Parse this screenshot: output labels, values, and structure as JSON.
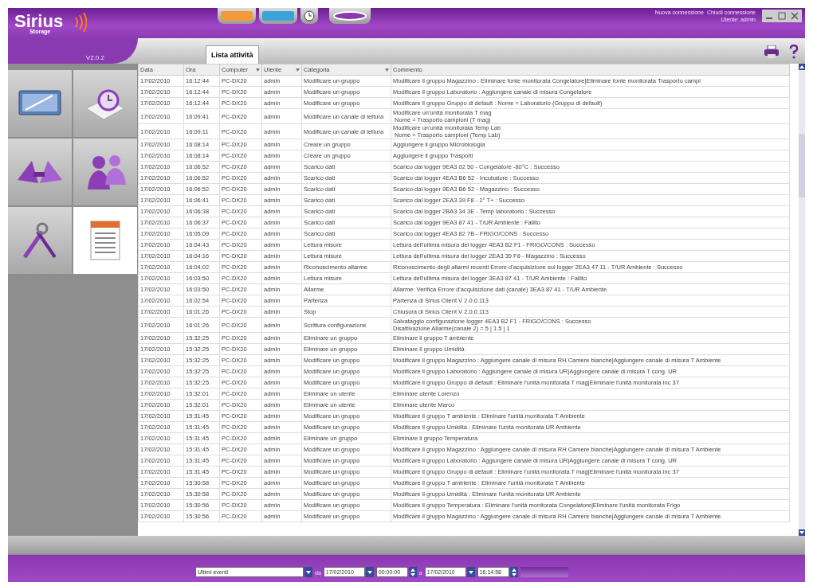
{
  "header": {
    "logo": "Sirius",
    "logo_sub": "Storage",
    "version": "V2.0.2",
    "links": [
      "Nuova connessione",
      "Chiudi connessione"
    ],
    "user": "Utente: admin"
  },
  "tab": {
    "label": "Lista attività",
    "selected": true
  },
  "nav_tiles": [
    {
      "kind": "monitor",
      "selected": false
    },
    {
      "kind": "clock",
      "selected": false
    },
    {
      "kind": "sensors",
      "selected": false
    },
    {
      "kind": "users",
      "selected": false
    },
    {
      "kind": "tools",
      "selected": false
    },
    {
      "kind": "log",
      "selected": true
    }
  ],
  "table": {
    "columns": [
      {
        "label": "Data",
        "filter": false
      },
      {
        "label": "Ora",
        "filter": false
      },
      {
        "label": "Computer",
        "filter": true
      },
      {
        "label": "Utente",
        "filter": true
      },
      {
        "label": "Categoria",
        "filter": true
      },
      {
        "label": "Commento",
        "filter": false
      }
    ],
    "rows": [
      {
        "data": "17/02/2010",
        "ora": "16:12:44",
        "computer": "PC-DX20",
        "utente": "admin",
        "categoria": "Modificare un gruppo",
        "commento": "Modificare il gruppo Magazzino : Eliminare fonte monitorata Congelatore|Eliminare fonte monitorata Trasporto campi"
      },
      {
        "data": "17/02/2010",
        "ora": "16:12:44",
        "computer": "PC-DX20",
        "utente": "admin",
        "categoria": "Modificare un gruppo",
        "commento": "Modificare il gruppo Laboratorio : Aggiungere canale di misura Congelatore"
      },
      {
        "data": "17/02/2010",
        "ora": "16:12:44",
        "computer": "PC-DX20",
        "utente": "admin",
        "categoria": "Modificare un gruppo",
        "commento": "Modificare il gruppo Gruppo di default : Nome = Laboratorio (Gruppo di default)"
      },
      {
        "data": "17/02/2010",
        "ora": "16:09:41",
        "computer": "PC-DX20",
        "utente": "admin",
        "categoria": "Modificare un canale di lettura",
        "commento": "Modificare un'unità monitorata T mag\n Nome = Trasporto campioni (T mag)"
      },
      {
        "data": "17/02/2010",
        "ora": "16:09:11",
        "computer": "PC-DX20",
        "utente": "admin",
        "categoria": "Modificare un canale di lettura",
        "commento": "Modificare un'unità monitorata Temp Lab\n Nome = Trasporto campioni (Temp Lab)"
      },
      {
        "data": "17/02/2010",
        "ora": "16:08:14",
        "computer": "PC-DX20",
        "utente": "admin",
        "categoria": "Creare un gruppo",
        "commento": "Aggiungere il gruppo Microbiologia"
      },
      {
        "data": "17/02/2010",
        "ora": "16:08:14",
        "computer": "PC-DX20",
        "utente": "admin",
        "categoria": "Creare un gruppo",
        "commento": "Aggiungere il gruppo Trasporti"
      },
      {
        "data": "17/02/2010",
        "ora": "16:06:52",
        "computer": "PC-DX20",
        "utente": "admin",
        "categoria": "Scarico dati",
        "commento": "Scarico dal logger 9EA3 02 50 - Congelatore -80°C : Successo"
      },
      {
        "data": "17/02/2010",
        "ora": "16:06:52",
        "computer": "PC-DX20",
        "utente": "admin",
        "categoria": "Scarico dati",
        "commento": "Scarico dal logger 4EA3 B6 52 - Incubatore : Successo"
      },
      {
        "data": "17/02/2010",
        "ora": "16:06:52",
        "computer": "PC-DX20",
        "utente": "admin",
        "categoria": "Scarico dati",
        "commento": "Scarico dal logger 9EA3 B6 52 - Magazzino : Successo"
      },
      {
        "data": "17/02/2010",
        "ora": "16:06:41",
        "computer": "PC-DX20",
        "utente": "admin",
        "categoria": "Scarico dati",
        "commento": "Scarico dal logger 2EA3 39 F8 - 2° T+ : Successo"
      },
      {
        "data": "17/02/2010",
        "ora": "16:06:38",
        "computer": "PC-DX20",
        "utente": "admin",
        "categoria": "Scarico dati",
        "commento": "Scarico dal logger 2BA3 34 3E - Temp laboratorio : Successo"
      },
      {
        "data": "17/02/2010",
        "ora": "16:06:37",
        "computer": "PC-DX20",
        "utente": "admin",
        "categoria": "Scarico dati",
        "commento": "Scarico dal logger 9EA3 87 41 - T/UR Ambiente : Fallito"
      },
      {
        "data": "17/02/2010",
        "ora": "16:05:09",
        "computer": "PC-DX20",
        "utente": "admin",
        "categoria": "Scarico dati",
        "commento": "Scarico dal logger 4EA3 82 7B - FRIGO/CONS : Successo"
      },
      {
        "data": "17/02/2010",
        "ora": "16:04:43",
        "computer": "PC-DX20",
        "utente": "admin",
        "categoria": "Lettura misure",
        "commento": "Lettura dell'ultima misura del logger 4EA3 B2 F1 - FRIGO/CONS : Successo"
      },
      {
        "data": "17/02/2010",
        "ora": "16:04:16",
        "computer": "PC-DX20",
        "utente": "admin",
        "categoria": "Lettura misure",
        "commento": "Lettura dell'ultima misura del logger 2EA3 39 F8 - Magazzino : Successo"
      },
      {
        "data": "17/02/2010",
        "ora": "16:04:02",
        "computer": "PC-DX20",
        "utente": "admin",
        "categoria": "Riconoscimento allarme",
        "commento": "Riconoscimento degli allarmi recenti Errore d'acquisizione sul logger 2EA3 47 11 - T/UR Ambiente : Successo"
      },
      {
        "data": "17/02/2010",
        "ora": "16:03:50",
        "computer": "PC-DX20",
        "utente": "admin",
        "categoria": "Lettura misure",
        "commento": "Lettura dell'ultima misura del logger 3EA3 87 41 - T/UR Ambiente : Fallito"
      },
      {
        "data": "17/02/2010",
        "ora": "16:03:50",
        "computer": "PC-DX20",
        "utente": "admin",
        "categoria": "Allarme",
        "commento": "Allarme: Verifica Errore d'acquisizione dati (canale) 3EA3 87 41 - T/UR Ambiente"
      },
      {
        "data": "17/02/2010",
        "ora": "16:02:54",
        "computer": "PC-DX20",
        "utente": "admin",
        "categoria": "Partenza",
        "commento": "Partenza di Sirius Client V 2.0.0.113"
      },
      {
        "data": "17/02/2010",
        "ora": "16:01:26",
        "computer": "PC-DX20",
        "utente": "admin",
        "categoria": "Stop",
        "commento": "Chiusura di Sirius Client V 2.0.0.113"
      },
      {
        "data": "17/02/2010",
        "ora": "16:01:26",
        "computer": "PC-DX20",
        "utente": "admin",
        "categoria": "Scrittura configurazione",
        "commento": "Salvataggio configurazione logger 4EA3 B2 F1 - FRIGO/CONS : Successo\nDisattivazione Allarme(canale 2) = 5 | 1.5 | 1"
      },
      {
        "data": "17/02/2010",
        "ora": "15:32:25",
        "computer": "PC-DX20",
        "utente": "admin",
        "categoria": "Eliminare un gruppo",
        "commento": "Eliminare il gruppo T ambiente"
      },
      {
        "data": "17/02/2010",
        "ora": "15:32:25",
        "computer": "PC-DX20",
        "utente": "admin",
        "categoria": "Eliminare un gruppo",
        "commento": "Eliminare il gruppo Umidità"
      },
      {
        "data": "17/02/2010",
        "ora": "15:32:25",
        "computer": "PC-DX20",
        "utente": "admin",
        "categoria": "Modificare un gruppo",
        "commento": "Modificare il gruppo Magazzino : Aggiungere canale di misura RH Camere bianche|Aggiungere canale di misura T Ambiente"
      },
      {
        "data": "17/02/2010",
        "ora": "15:32:25",
        "computer": "PC-DX20",
        "utente": "admin",
        "categoria": "Modificare un gruppo",
        "commento": "Modificare il gruppo Laboratorio : Aggiungere canale di misura UR|Aggiungere canale di misura T cong. UR"
      },
      {
        "data": "17/02/2010",
        "ora": "15:32:25",
        "computer": "PC-DX20",
        "utente": "admin",
        "categoria": "Modificare un gruppo",
        "commento": "Modificare il gruppo Gruppo di default : Eliminare l'unità monitorata T mag|Eliminare l'unità monitorata inc 37"
      },
      {
        "data": "17/02/2010",
        "ora": "15:32:01",
        "computer": "PC-DX20",
        "utente": "admin",
        "categoria": "Eliminare un utente",
        "commento": "Eliminare utente Lorenzo"
      },
      {
        "data": "17/02/2010",
        "ora": "15:32:01",
        "computer": "PC-DX20",
        "utente": "admin",
        "categoria": "Eliminare un utente",
        "commento": "Eliminare utente Marco"
      },
      {
        "data": "17/02/2010",
        "ora": "15:31:45",
        "computer": "PC-DX20",
        "utente": "admin",
        "categoria": "Modificare un gruppo",
        "commento": "Modificare il gruppo T ambiente : Eliminare l'unità monitorata T Ambiente"
      },
      {
        "data": "17/02/2010",
        "ora": "15:31:45",
        "computer": "PC-DX20",
        "utente": "admin",
        "categoria": "Modificare un gruppo",
        "commento": "Modificare il gruppo Umidità : Eliminare l'unità monitorata UR Ambiente"
      },
      {
        "data": "17/02/2010",
        "ora": "15:31:45",
        "computer": "PC-DX20",
        "utente": "admin",
        "categoria": "Eliminare un gruppo",
        "commento": "Eliminare il gruppo Temperatura"
      },
      {
        "data": "17/02/2010",
        "ora": "15:31:45",
        "computer": "PC-DX20",
        "utente": "admin",
        "categoria": "Modificare un gruppo",
        "commento": "Modificare il gruppo Magazzino : Aggiungere canale di misura RH Camere bianche|Aggiungere canale di misura T Ambiente"
      },
      {
        "data": "17/02/2010",
        "ora": "15:31:45",
        "computer": "PC-DX20",
        "utente": "admin",
        "categoria": "Modificare un gruppo",
        "commento": "Modificare il gruppo Laboratorio : Aggiungere canale di misura UR|Aggiungere canale di misura T cong. UR"
      },
      {
        "data": "17/02/2010",
        "ora": "15:31:45",
        "computer": "PC-DX20",
        "utente": "admin",
        "categoria": "Modificare un gruppo",
        "commento": "Modificare il gruppo Gruppo di default : Eliminare l'unità monitorata T mag|Eliminare l'unità monitorata inc 37"
      },
      {
        "data": "17/02/2010",
        "ora": "15:30:58",
        "computer": "PC-DX20",
        "utente": "admin",
        "categoria": "Modificare un gruppo",
        "commento": "Modificare il gruppo T ambiente : Eliminare l'unità monitorata T Ambiente"
      },
      {
        "data": "17/02/2010",
        "ora": "15:30:58",
        "computer": "PC-DX20",
        "utente": "admin",
        "categoria": "Modificare un gruppo",
        "commento": "Modificare il gruppo Umidità : Eliminare l'unità monitorata UR Ambiente"
      },
      {
        "data": "17/02/2010",
        "ora": "15:30:56",
        "computer": "PC-DX20",
        "utente": "admin",
        "categoria": "Modificare un gruppo",
        "commento": "Modificare il gruppo Temperatura : Eliminare l'unità monitorata Congelatore|Eliminare l'unità monitorata Frigo"
      },
      {
        "data": "17/02/2010",
        "ora": "15:30:56",
        "computer": "PC-DX20",
        "utente": "admin",
        "categoria": "Modificare un gruppo",
        "commento": "Modificare il gruppo Magazzino : Aggiungere canale di misura RH Camere bianche|Aggiungere canale di misura T Ambiente"
      }
    ]
  },
  "filter_bar": {
    "period": "Ultimi eventi",
    "from_label": "da",
    "from_date": "17/02/2010",
    "from_time": "00:00:00",
    "to_label": "a",
    "to_date": "17/02/2010",
    "to_time": "16:14:58"
  }
}
